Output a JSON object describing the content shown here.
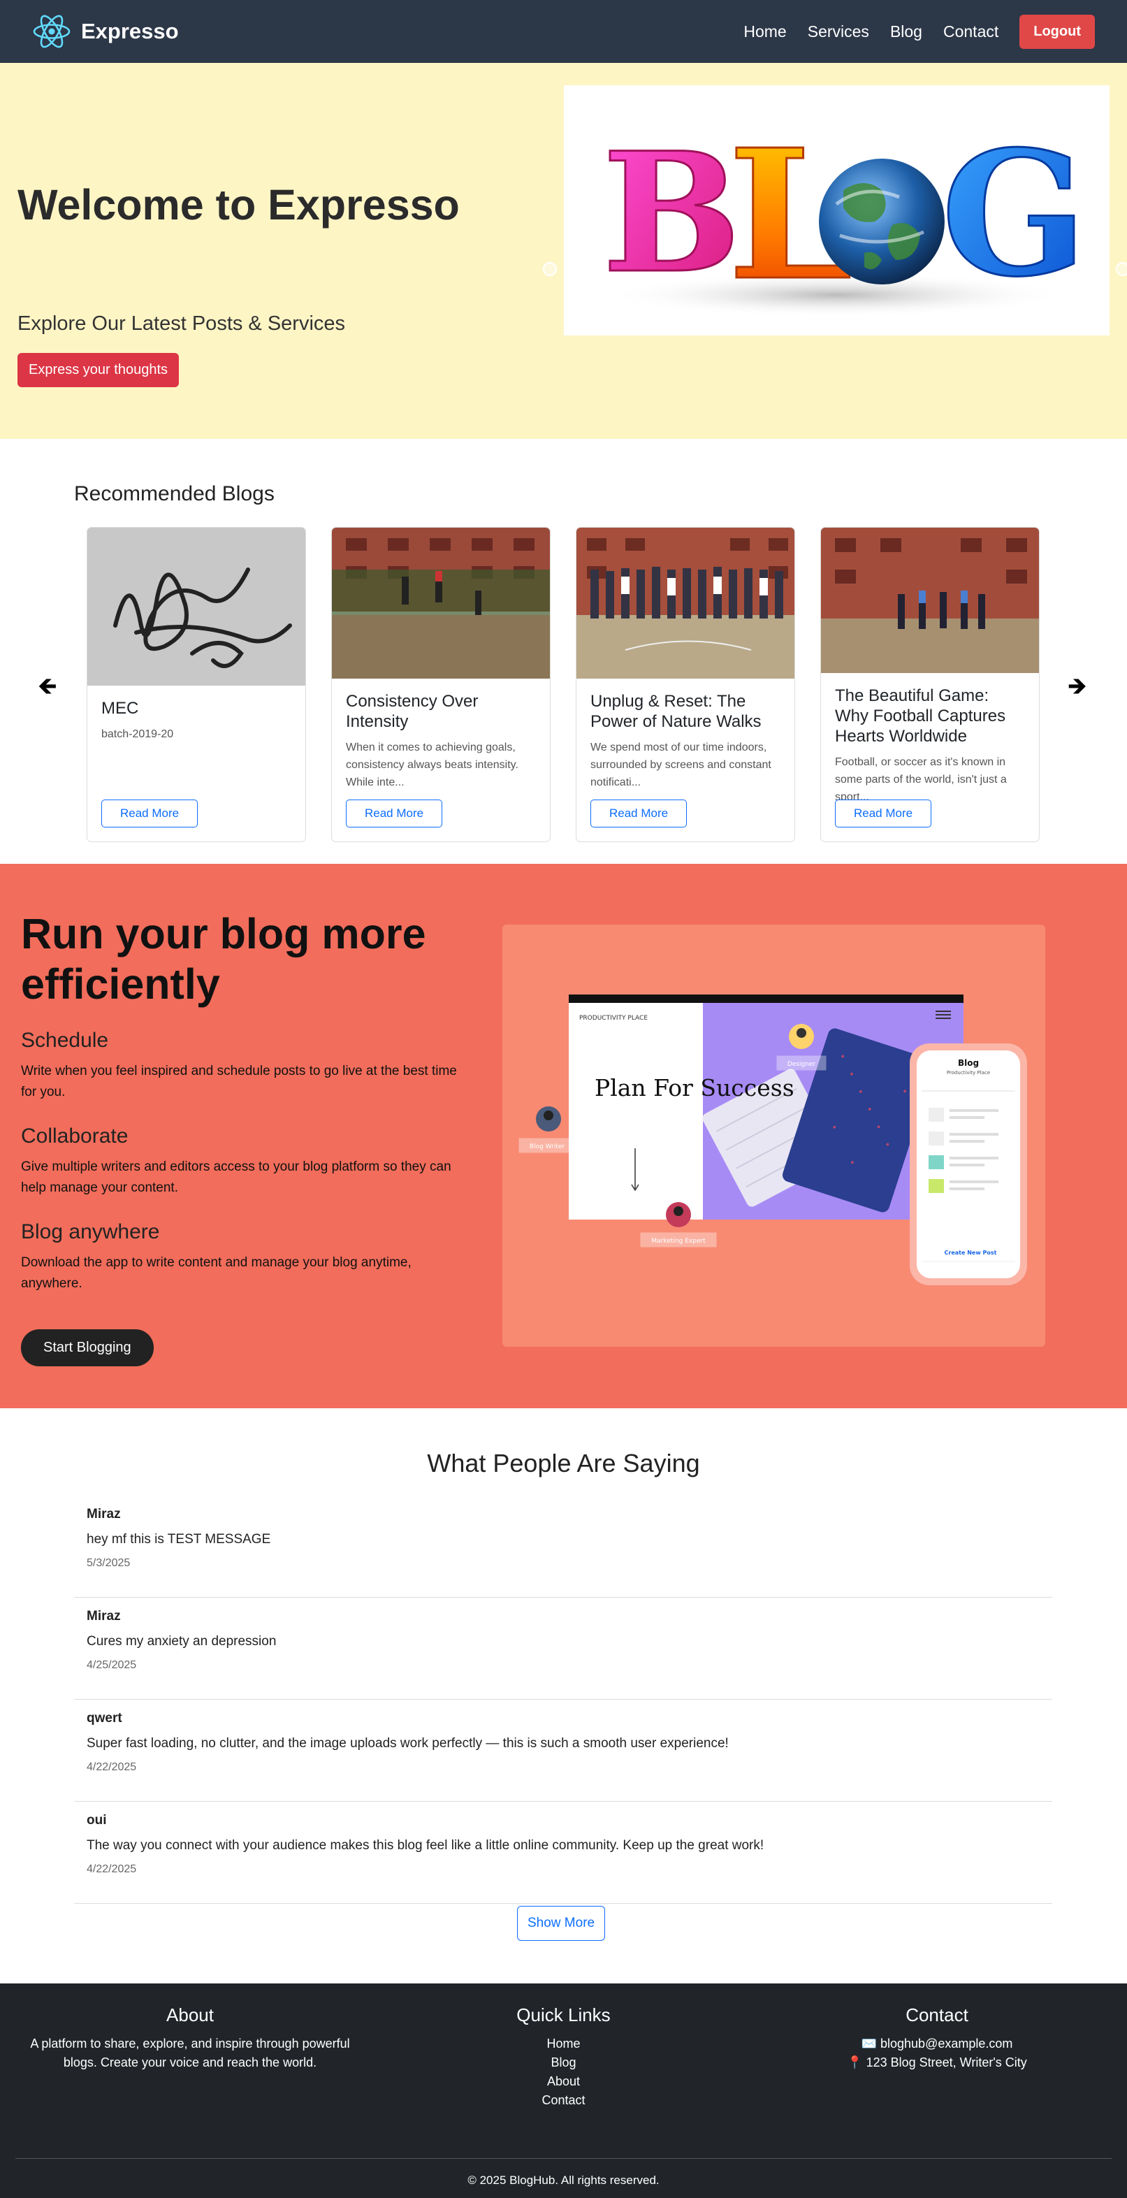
{
  "nav": {
    "brand": "Expresso",
    "links": [
      "Home",
      "Services",
      "Blog",
      "Contact"
    ],
    "logout": "Logout"
  },
  "hero": {
    "title": "Welcome to Expresso",
    "subtitle": "Explore Our Latest Posts & Services",
    "cta": "Express your thoughts",
    "image_text": "BLOG"
  },
  "recommended": {
    "heading": "Recommended Blogs",
    "cards": [
      {
        "title": "MEC",
        "excerpt": "batch-2019-20",
        "button": "Read More"
      },
      {
        "title": "Consistency Over Intensity",
        "excerpt": "When it comes to achieving goals, consistency always beats intensity. While inte...",
        "button": "Read More"
      },
      {
        "title": "Unplug & Reset: The Power of Nature Walks",
        "excerpt": "We spend most of our time indoors, surrounded by screens and constant notificati...",
        "button": "Read More"
      },
      {
        "title": "The Beautiful Game: Why Football Captures Hearts Worldwide",
        "excerpt": "Football, or soccer as it's known in some parts of the world, isn't just a sport...",
        "button": "Read More"
      }
    ]
  },
  "features": {
    "heading": "Run your blog more efficiently",
    "items": [
      {
        "title": "Schedule",
        "text": "Write when you feel inspired and schedule posts to go live at the best time for you."
      },
      {
        "title": "Collaborate",
        "text": "Give multiple writers and editors access to your blog platform so they can help manage your content."
      },
      {
        "title": "Blog anywhere",
        "text": "Download the app to write content and manage your blog anytime, anywhere."
      }
    ],
    "cta": "Start Blogging",
    "mock": {
      "brand": "PRODUCTIVITY PLACE",
      "headline": "Plan For Success",
      "tag_designer": "Designer",
      "tag_writer": "Blog Writer",
      "tag_marketing": "Marketing Expert",
      "phone_title": "Blog",
      "phone_sub": "Productivity Place",
      "phone_cta": "Create New Post"
    }
  },
  "testimonials": {
    "heading": "What People Are Saying",
    "items": [
      {
        "name": "Miraz",
        "message": "hey mf this is TEST MESSAGE",
        "date": "5/3/2025"
      },
      {
        "name": "Miraz",
        "message": "Cures my anxiety an depression",
        "date": "4/25/2025"
      },
      {
        "name": "qwert",
        "message": "Super fast loading, no clutter, and the image uploads work perfectly — this is such a smooth user experience!",
        "date": "4/22/2025"
      },
      {
        "name": "oui",
        "message": "The way you connect with your audience makes this blog feel like a little online community. Keep up the great work!",
        "date": "4/22/2025"
      }
    ],
    "show_more": "Show More"
  },
  "footer": {
    "about_title": "About",
    "about_text": "A platform to share, explore, and inspire through powerful blogs. Create your voice and reach the world.",
    "links_title": "Quick Links",
    "links": [
      "Home",
      "Blog",
      "About",
      "Contact"
    ],
    "contact_title": "Contact",
    "email": "✉️ bloghub@example.com",
    "address": "📍 123 Blog Street, Writer's City",
    "copyright": "© 2025 BlogHub. All rights reserved."
  }
}
